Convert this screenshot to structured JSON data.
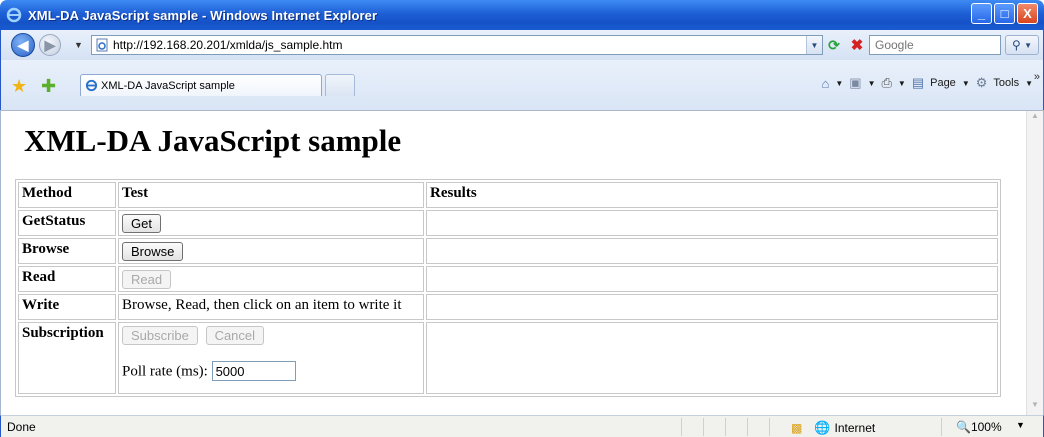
{
  "window": {
    "title": "XML-DA JavaScript sample - Windows Internet Explorer",
    "minimize_glyph": "_",
    "maximize_glyph": "□",
    "close_glyph": "X"
  },
  "toolbar": {
    "url": "http://192.168.20.201/xmlda/js_sample.htm",
    "search_placeholder": "Google"
  },
  "tabs": [
    {
      "label": "XML-DA JavaScript sample",
      "active": true
    }
  ],
  "commands": {
    "page_label": "Page",
    "tools_label": "Tools"
  },
  "page": {
    "heading": "XML-DA JavaScript sample",
    "columns": [
      "Method",
      "Test",
      "Results"
    ],
    "rows": {
      "getstatus": {
        "method": "GetStatus",
        "button": "Get"
      },
      "browse": {
        "method": "Browse",
        "button": "Browse"
      },
      "read": {
        "method": "Read",
        "button": "Read"
      },
      "write": {
        "method": "Write",
        "text": "Browse, Read, then click on an item to write it"
      },
      "subscription": {
        "method": "Subscription",
        "subscribe_button": "Subscribe",
        "cancel_button": "Cancel",
        "poll_label": "Poll rate (ms):",
        "poll_value": "5000"
      }
    }
  },
  "statusbar": {
    "status": "Done",
    "zone": "Internet",
    "zoom": "100%"
  },
  "colors": {
    "titlebar": "#1e5fd6",
    "accent": "#2656c8"
  }
}
